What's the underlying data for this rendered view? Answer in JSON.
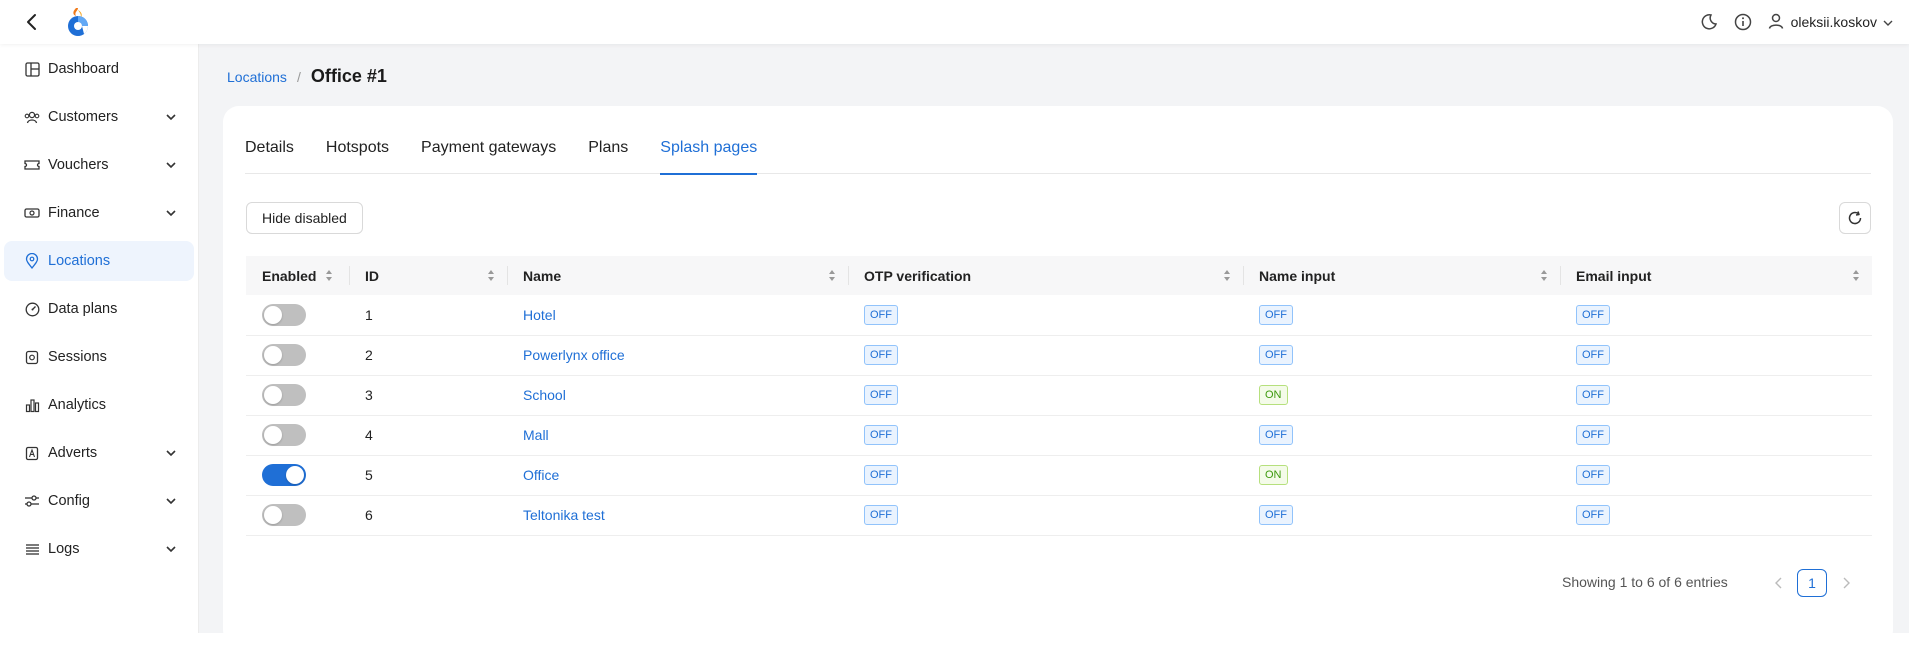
{
  "topbar": {
    "username": "oleksii.koskov"
  },
  "sidebar": {
    "items": [
      {
        "label": "Dashboard",
        "icon": "dashboard-icon",
        "expandable": false,
        "active": false
      },
      {
        "label": "Customers",
        "icon": "customers-icon",
        "expandable": true,
        "active": false
      },
      {
        "label": "Vouchers",
        "icon": "ticket-icon",
        "expandable": true,
        "active": false
      },
      {
        "label": "Finance",
        "icon": "money-icon",
        "expandable": true,
        "active": false
      },
      {
        "label": "Locations",
        "icon": "location-pin-icon",
        "expandable": false,
        "active": true
      },
      {
        "label": "Data plans",
        "icon": "dashboard-gauge-icon",
        "expandable": false,
        "active": false
      },
      {
        "label": "Sessions",
        "icon": "sessions-icon",
        "expandable": false,
        "active": false
      },
      {
        "label": "Analytics",
        "icon": "bar-chart-icon",
        "expandable": false,
        "active": false
      },
      {
        "label": "Adverts",
        "icon": "advert-icon",
        "expandable": true,
        "active": false
      },
      {
        "label": "Config",
        "icon": "sliders-icon",
        "expandable": true,
        "active": false
      },
      {
        "label": "Logs",
        "icon": "list-icon",
        "expandable": true,
        "active": false
      }
    ]
  },
  "breadcrumb": {
    "parent": "Locations",
    "separator": "/",
    "current": "Office #1"
  },
  "tabs": [
    {
      "label": "Details",
      "active": false
    },
    {
      "label": "Hotspots",
      "active": false
    },
    {
      "label": "Payment gateways",
      "active": false
    },
    {
      "label": "Plans",
      "active": false
    },
    {
      "label": "Splash pages",
      "active": true
    }
  ],
  "toolbar": {
    "hide_disabled_label": "Hide disabled"
  },
  "table": {
    "headers": [
      "Enabled",
      "ID",
      "Name",
      "OTP verification",
      "Name input",
      "Email input"
    ],
    "rows": [
      {
        "enabled": false,
        "id": "1",
        "name": "Hotel",
        "otp": "OFF",
        "name_input": "OFF",
        "email_input": "OFF"
      },
      {
        "enabled": false,
        "id": "2",
        "name": "Powerlynx office",
        "otp": "OFF",
        "name_input": "OFF",
        "email_input": "OFF"
      },
      {
        "enabled": false,
        "id": "3",
        "name": "School",
        "otp": "OFF",
        "name_input": "ON",
        "email_input": "OFF"
      },
      {
        "enabled": false,
        "id": "4",
        "name": "Mall",
        "otp": "OFF",
        "name_input": "OFF",
        "email_input": "OFF"
      },
      {
        "enabled": true,
        "id": "5",
        "name": "Office",
        "otp": "OFF",
        "name_input": "ON",
        "email_input": "OFF"
      },
      {
        "enabled": false,
        "id": "6",
        "name": "Teltonika test",
        "otp": "OFF",
        "name_input": "OFF",
        "email_input": "OFF"
      }
    ]
  },
  "pagination": {
    "info": "Showing 1 to 6 of 6 entries",
    "current_page": "1"
  },
  "colors": {
    "accent": "#1f6fd6",
    "on_badge": "#3e9a0f",
    "active_nav_bg": "#eef4fd"
  }
}
